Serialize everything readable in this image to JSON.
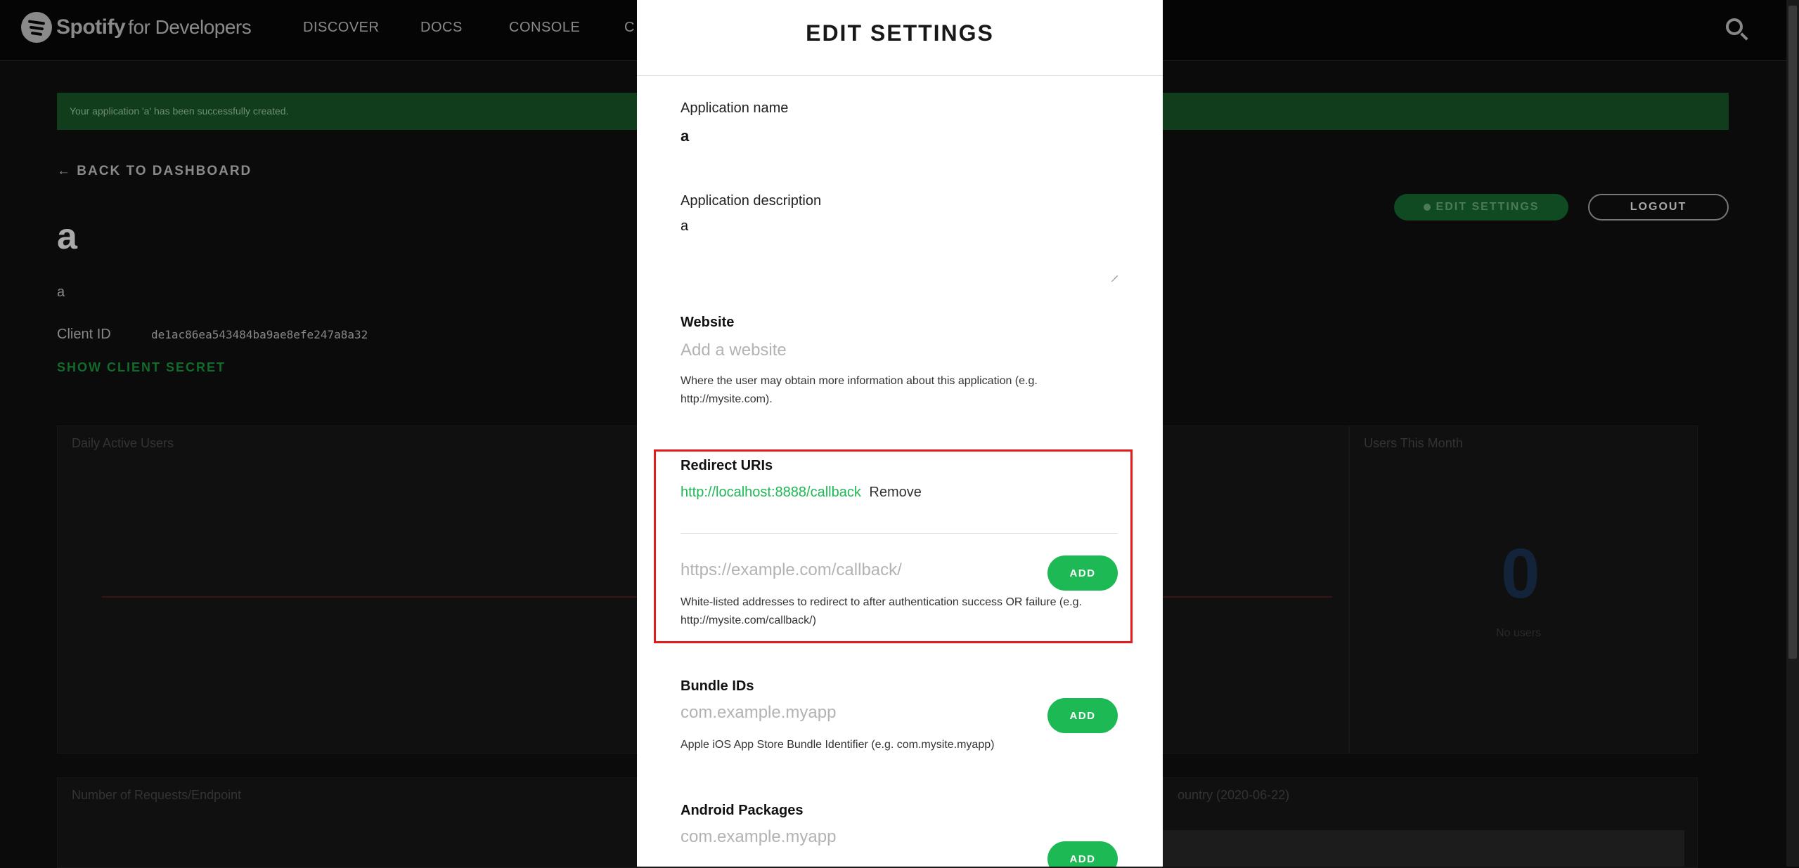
{
  "topnav": {
    "brand": "Spotify",
    "brand_suffix": "for Developers",
    "items": [
      "DISCOVER",
      "DOCS",
      "CONSOLE",
      "C"
    ],
    "icons": [
      "spotify-logo-icon",
      "search-icon"
    ]
  },
  "banner": {
    "text": "Your application 'a' has been successfully created."
  },
  "dashboard": {
    "back_label": "BACK TO DASHBOARD",
    "app_name": "a",
    "app_description": "a",
    "client_id_label": "Client ID",
    "client_id": "de1ac86ea543484ba9ae8efe247a8a32",
    "show_secret_label": "SHOW CLIENT SECRET",
    "edit_settings_label": "EDIT SETTINGS",
    "logout_label": "LOGOUT"
  },
  "panels": {
    "daily_users_title": "Daily Active Users",
    "monthly_users_title": "Users This Month",
    "monthly_users_value": "0",
    "monthly_users_sub": "No users",
    "requests_title": "Number of Requests/Endpoint",
    "country_title": "ountry (2020-06-22)"
  },
  "modal": {
    "title": "EDIT SETTINGS",
    "app_name_label": "Application name",
    "app_name_value": "a",
    "app_desc_label": "Application description",
    "app_desc_value": "a",
    "website_label": "Website",
    "website_placeholder": "Add a website",
    "website_help": "Where the user may obtain more information about this application (e.g. http://mysite.com).",
    "redirect_label": "Redirect URIs",
    "redirect_uri": "http://localhost:8888/callback",
    "redirect_remove": "Remove",
    "redirect_placeholder": "https://example.com/callback/",
    "redirect_help": "White-listed addresses to redirect to after authentication success OR failure (e.g. http://mysite.com/callback/)",
    "add_label": "ADD",
    "bundle_label": "Bundle IDs",
    "bundle_placeholder": "com.example.myapp",
    "bundle_help": "Apple iOS App Store Bundle Identifier (e.g. com.mysite.myapp)",
    "android_label": "Android Packages",
    "android_placeholder": "com.example.myapp"
  },
  "colors": {
    "accent": "#1db954",
    "highlight": "#e21b1b",
    "overlay": "#0b0b0b"
  }
}
